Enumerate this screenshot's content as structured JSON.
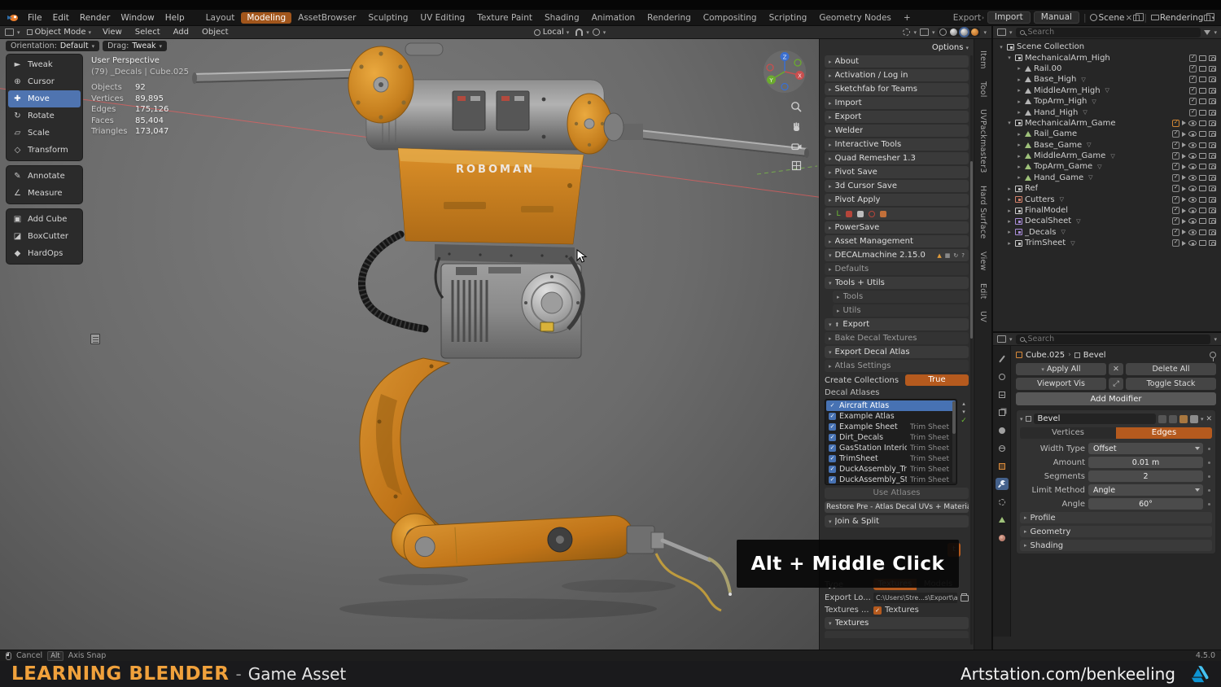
{
  "topbar": {
    "menus": [
      "File",
      "Edit",
      "Render",
      "Window",
      "Help"
    ],
    "workspaces": [
      "Layout",
      "Modeling",
      "AssetBrowser",
      "Sculpting",
      "UV Editing",
      "Texture Paint",
      "Shading",
      "Animation",
      "Rendering",
      "Compositing",
      "Scripting",
      "Geometry Nodes",
      "+"
    ],
    "export_label": "Export",
    "import_label": "Import",
    "manual_label": "Manual",
    "scene_label": "Scene",
    "rendering_label": "Rendering"
  },
  "header": {
    "mode": "Object Mode",
    "menu_view": "View",
    "menu_select": "Select",
    "menu_add": "Add",
    "menu_object": "Object",
    "orientation": "Local",
    "options_label": "Options"
  },
  "viewport": {
    "orientation_label": "Orientation:",
    "orientation_value": "Default",
    "drag_label": "Drag:",
    "drag_value": "Tweak",
    "stats": {
      "title": "User Perspective",
      "context": "(79) _Decals | Cube.025",
      "rows": [
        {
          "label": "Objects",
          "value": "92"
        },
        {
          "label": "Vertices",
          "value": "89,895"
        },
        {
          "label": "Edges",
          "value": "175,126"
        },
        {
          "label": "Faces",
          "value": "85,404"
        },
        {
          "label": "Triangles",
          "value": "173,047"
        }
      ]
    },
    "model_label": "ROBOMAN"
  },
  "tools": [
    {
      "label": "Tweak"
    },
    {
      "label": "Cursor"
    },
    {
      "label": "Move"
    },
    {
      "label": "Rotate"
    },
    {
      "label": "Scale"
    },
    {
      "label": "Transform"
    },
    {
      "label": "Annotate"
    },
    {
      "label": "Measure"
    },
    {
      "label": "Add Cube"
    },
    {
      "label": "BoxCutter"
    },
    {
      "label": "HardOps"
    }
  ],
  "npanel": {
    "sections": [
      "About",
      "Activation / Log in",
      "Sketchfab for Teams",
      "Import",
      "Export",
      "Welder",
      "Interactive Tools",
      "Quad Remesher 1.3",
      "Pivot Save",
      "3d Cursor Save",
      "Pivot Apply",
      "PowerSave",
      "Asset Management"
    ],
    "decal": {
      "title": "DECALmachine 2.15.0",
      "defaults": "Defaults",
      "tools_utils": "Tools + Utils",
      "tools": "Tools",
      "utils": "Utils",
      "export": "Export",
      "bake": "Bake Decal Textures",
      "export_atlas": "Export Decal Atlas",
      "atlas_settings": "Atlas Settings",
      "create_collections": "Create Collections",
      "create_collections_value": "True",
      "decal_atlases": "Decal Atlases",
      "atlases": [
        {
          "name": "Aircraft Atlas",
          "type": ""
        },
        {
          "name": "Example Atlas",
          "type": ""
        },
        {
          "name": "Example Sheet",
          "type": "Trim Sheet"
        },
        {
          "name": "Dirt_Decals",
          "type": "Trim Sheet"
        },
        {
          "name": "GasStation Interior",
          "type": "Trim Sheet"
        },
        {
          "name": "TrimSheet",
          "type": "Trim Sheet"
        },
        {
          "name": "DuckAssembly_Tri...",
          "type": "Trim Sheet"
        },
        {
          "name": "DuckAssembly_Stic...",
          "type": "Trim Sheet"
        }
      ],
      "use_atlases": "Use Atlases",
      "restore": "Restore Pre - Atlas Decal UVs + Materials",
      "join_split": "Join & Split",
      "type_label": "Type",
      "type_textures": "Textures",
      "type_models": "Models",
      "export_location_label": "Export Lo...",
      "export_location_value": "C:\\Users\\Stre...s\\Export\\atlas",
      "textures_label": "Textures ...",
      "textures_value": "Textures",
      "textures_header": "Textures"
    }
  },
  "side_tabs": [
    "Item",
    "Tool",
    "UVPackmaster3",
    "Hard Surface",
    "View",
    "Edit",
    "UV"
  ],
  "outliner": {
    "search_placeholder": "Search",
    "rows": [
      {
        "label": "Scene Collection"
      },
      {
        "label": "MechanicalArm_High"
      },
      {
        "label": "Rail.00"
      },
      {
        "label": "Base_High"
      },
      {
        "label": "MiddleArm_High"
      },
      {
        "label": "TopArm_High"
      },
      {
        "label": "Hand_High"
      },
      {
        "label": "MechanicalArm_Game"
      },
      {
        "label": "Rail_Game"
      },
      {
        "label": "Base_Game"
      },
      {
        "label": "MiddleArm_Game"
      },
      {
        "label": "TopArm_Game"
      },
      {
        "label": "Hand_Game"
      },
      {
        "label": "Ref"
      },
      {
        "label": "Cutters"
      },
      {
        "label": "FinalModel"
      },
      {
        "label": "DecalSheet"
      },
      {
        "label": "_Decals"
      },
      {
        "label": "TrimSheet"
      }
    ]
  },
  "properties": {
    "search_placeholder": "Search",
    "breadcrumb_object": "Cube.025",
    "breadcrumb_modifier": "Bevel",
    "apply_all": "Apply All",
    "delete_all": "Delete All",
    "viewport_vis": "Viewport Vis",
    "toggle_stack": "Toggle Stack",
    "add_modifier": "Add Modifier",
    "modifier": {
      "name": "Bevel",
      "vertices": "Vertices",
      "edges": "Edges",
      "width_type_label": "Width Type",
      "width_type_value": "Offset",
      "amount_label": "Amount",
      "amount_value": "0.01 m",
      "segments_label": "Segments",
      "segments_value": "2",
      "limit_label": "Limit Method",
      "limit_value": "Angle",
      "angle_label": "Angle",
      "angle_value": "60°",
      "profile": "Profile",
      "geometry": "Geometry",
      "shading": "Shading"
    }
  },
  "tooltip": {
    "text": "Alt + Middle Click"
  },
  "statusbar": {
    "cancel": "Cancel",
    "snap_key": "Alt",
    "snap_label": "Axis Snap",
    "version": "4.5.0"
  },
  "banner": {
    "title": "LEARNING BLENDER",
    "separator": "-",
    "subtitle": "Game Asset",
    "handle": "Artstation.com/benkeeling"
  },
  "colors": {
    "accent_orange": "#b55a1e",
    "select_blue": "#4772b3",
    "banner_orange": "#f0a13c",
    "artstation_blue": "#13a9e1"
  }
}
